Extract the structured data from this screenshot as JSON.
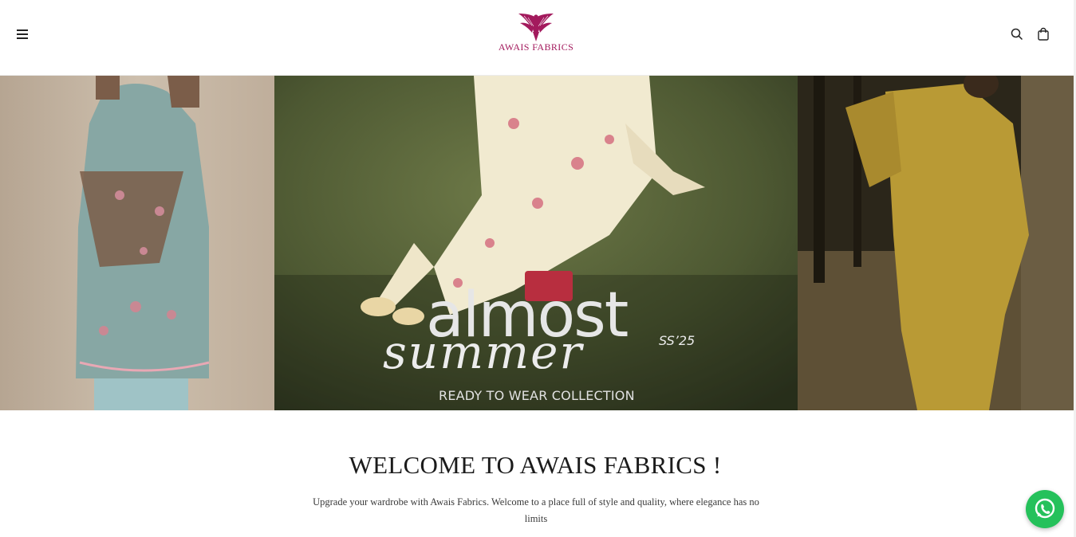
{
  "header": {
    "menu_icon": "hamburger-menu-icon",
    "logo_text": "AWAIS FABRICS",
    "search_icon": "search-icon",
    "cart_icon": "shopping-bag-icon"
  },
  "hero": {
    "title": "almost",
    "script": "summer",
    "badge": "SS’25",
    "subtitle": "READY TO WEAR COLLECTION"
  },
  "welcome": {
    "title": "WELCOME TO AWAIS FABRICS !",
    "text": "Upgrade your wardrobe with Awais Fabrics. Welcome to a place full of style and quality, where elegance has no limits"
  },
  "floating": {
    "whatsapp_icon": "whatsapp-icon"
  },
  "colors": {
    "brand": "#a31a5d",
    "whatsapp": "#25c15b"
  }
}
